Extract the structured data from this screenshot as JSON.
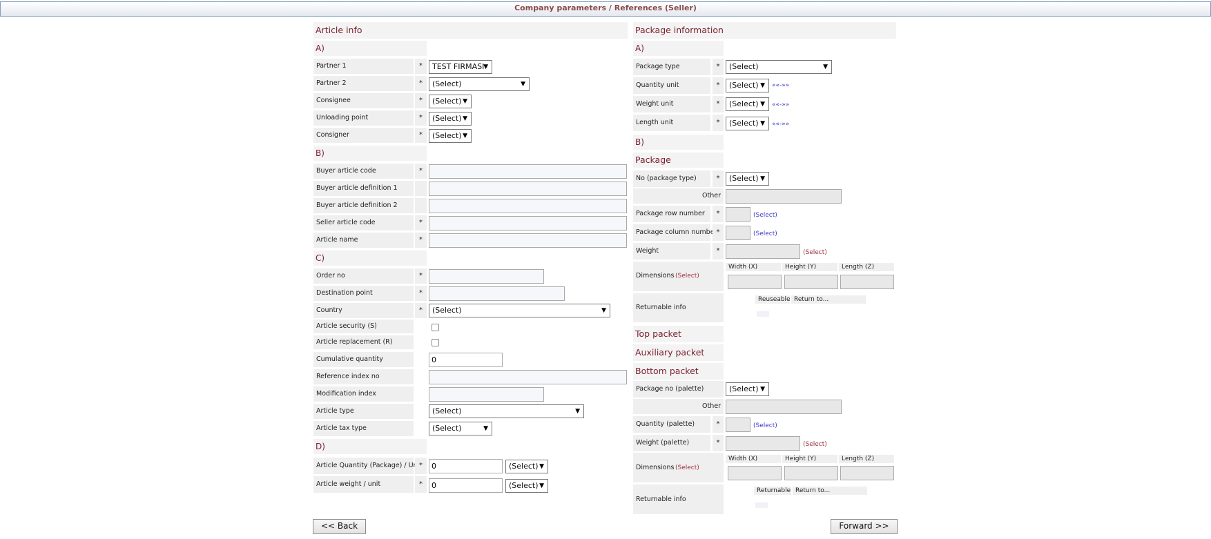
{
  "title": "Company parameters / References (Seller)",
  "left": {
    "header": "Article info",
    "section_a": "A)",
    "partner1_label": "Partner 1",
    "partner1_value": "TEST FIRMASI",
    "partner2_label": "Partner 2",
    "partner2_value": "(Select)",
    "consignee_label": "Consignee",
    "consignee_value": "(Select)",
    "unloading_label": "Unloading point",
    "unloading_value": "(Select)",
    "consigner_label": "Consigner",
    "consigner_value": "(Select)",
    "section_b": "B)",
    "buyer_code_label": "Buyer article code",
    "buyer_def1_label": "Buyer article definition 1",
    "buyer_def2_label": "Buyer article definition 2",
    "seller_code_label": "Seller article code",
    "article_name_label": "Article name",
    "section_c": "C)",
    "order_no_label": "Order no",
    "destination_label": "Destination point",
    "country_label": "Country",
    "country_value": "(Select)",
    "security_label": "Article security (S)",
    "replacement_label": "Article replacement (R)",
    "cumulative_label": "Cumulative quantity",
    "cumulative_value": "0",
    "ref_index_label": "Reference index no",
    "mod_index_label": "Modification index",
    "article_type_label": "Article type",
    "article_type_value": "(Select)",
    "tax_type_label": "Article tax type",
    "tax_type_value": "(Select)",
    "section_d": "D)",
    "qty_unit_label": "Article Quantity (Package) / Unit",
    "qty_unit_value": "0",
    "qty_unit_select": "(Select)",
    "weight_unit_label": "Article weight / unit",
    "weight_unit_value": "0",
    "weight_unit_select": "(Select)"
  },
  "right": {
    "header": "Package information",
    "section_a": "A)",
    "pkg_type_label": "Package type",
    "pkg_type_value": "(Select)",
    "qty_unit_label": "Quantity unit",
    "qty_unit_value": "(Select)",
    "weight_unit_label": "Weight unit",
    "weight_unit_value": "(Select)",
    "length_unit_label": "Length unit",
    "length_unit_value": "(Select)",
    "range_link": "««-»»",
    "section_b": "B)",
    "package_header": "Package",
    "no_pkg_label": "No (package type)",
    "no_pkg_value": "(Select)",
    "other_label": "Other",
    "row_number_label": "Package row number",
    "col_number_label": "Package column number",
    "weight_label": "Weight",
    "select_link": "(Select)",
    "dimensions_label": "Dimensions",
    "width_label": "Width (X)",
    "height_label": "Height (Y)",
    "length_label": "Length (Z)",
    "returnable_info_label": "Returnable info",
    "reuseable_label": "Reuseable",
    "return_to_label": "Return to...",
    "top_packet": "Top packet",
    "aux_packet": "Auxiliary packet",
    "bottom_packet": "Bottom packet",
    "pkg_no_palette_label": "Package no (palette)",
    "pkg_no_palette_value": "(Select)",
    "other2_label": "Other",
    "qty_palette_label": "Quantity (palette)",
    "weight_palette_label": "Weight (palette)",
    "dimensions2_label": "Dimensions",
    "width2_label": "Width (X)",
    "height2_label": "Height (Y)",
    "length2_label": "Length (Z)",
    "returnable_info2_label": "Returnable info",
    "returnable_label": "Returnable",
    "return_to2_label": "Return to..."
  },
  "buttons": {
    "back": "<< Back",
    "forward": "Forward >>"
  }
}
